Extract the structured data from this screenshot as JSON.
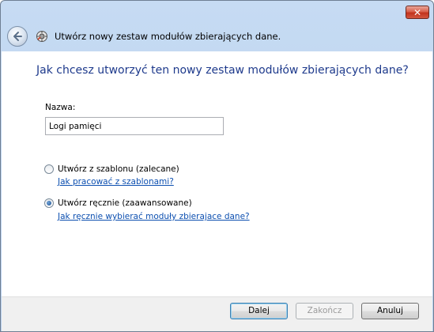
{
  "window": {
    "close_label": "✕"
  },
  "header": {
    "title": "Utwórz nowy zestaw modułów zbierających dane."
  },
  "content": {
    "heading": "Jak chcesz utworzyć ten nowy zestaw modułów zbierających dane?",
    "name_label": "Nazwa:",
    "name_value": "Logi pamięci",
    "option_template": {
      "label": "Utwórz z szablonu (zalecane)",
      "link": "Jak pracować z szablonami?",
      "checked": false
    },
    "option_manual": {
      "label": "Utwórz ręcznie (zaawansowane)",
      "link": "Jak ręcznie wybierać moduły zbierajace dane?",
      "checked": true
    }
  },
  "footer": {
    "next_label": "Dalej",
    "finish_label": "Zakończ",
    "cancel_label": "Anuluj"
  }
}
